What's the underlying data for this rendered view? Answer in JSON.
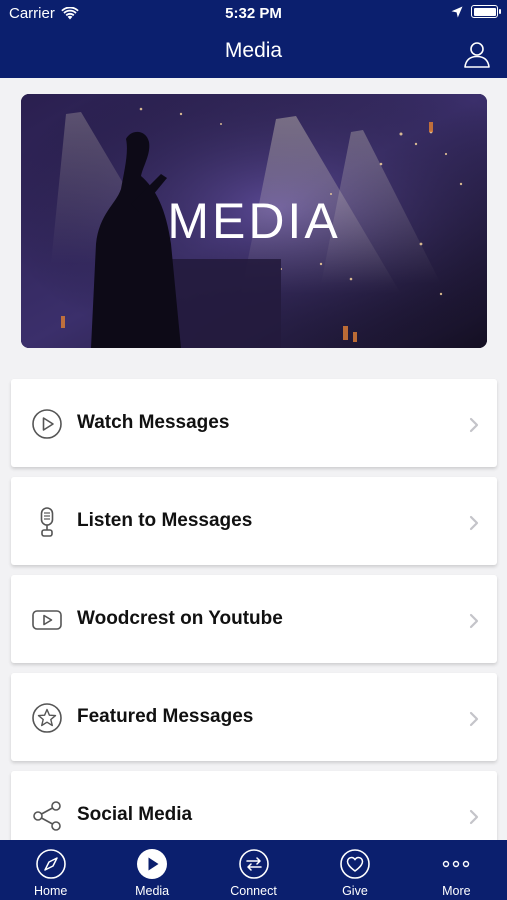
{
  "status_bar": {
    "carrier": "Carrier",
    "time": "5:32 PM"
  },
  "header": {
    "title": "Media"
  },
  "hero": {
    "title": "MEDIA"
  },
  "menu": [
    {
      "label": "Watch Messages",
      "icon": "play-circle-icon"
    },
    {
      "label": "Listen to Messages",
      "icon": "microphone-icon"
    },
    {
      "label": "Woodcrest on Youtube",
      "icon": "youtube-icon"
    },
    {
      "label": "Featured Messages",
      "icon": "star-circle-icon"
    },
    {
      "label": "Social Media",
      "icon": "share-icon"
    }
  ],
  "tabs": [
    {
      "label": "Home",
      "icon": "compass-icon"
    },
    {
      "label": "Media",
      "icon": "play-circle-icon",
      "active": true
    },
    {
      "label": "Connect",
      "icon": "swap-arrows-icon"
    },
    {
      "label": "Give",
      "icon": "heart-circle-icon"
    },
    {
      "label": "More",
      "icon": "dots-icon"
    }
  ],
  "colors": {
    "brand": "#0b1f6e",
    "background": "#f2f2f4",
    "card": "#ffffff",
    "icon_gray": "#555555",
    "chevron": "#c4c4c9"
  }
}
